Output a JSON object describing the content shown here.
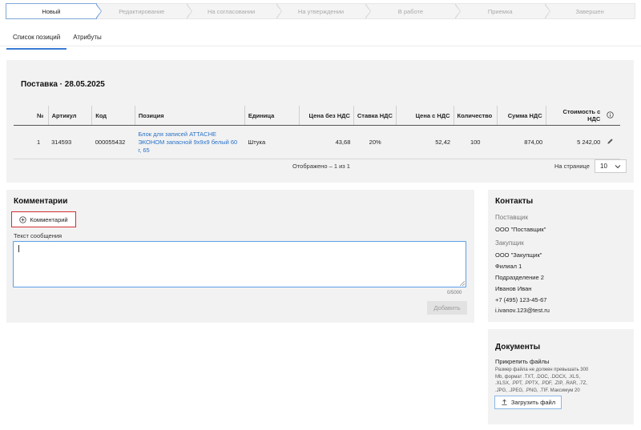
{
  "stepper": [
    "Новый",
    "Редактирование",
    "На согласовании",
    "На утверждении",
    "В работе",
    "Приемка",
    "Завершен"
  ],
  "tabs": [
    "Список позиций",
    "Атрибуты"
  ],
  "delivery": {
    "title": "Поставка · 28.05.2025",
    "columns": {
      "num": "№",
      "article": "Артикул",
      "code": "Код",
      "position": "Позиция",
      "unit": "Единица",
      "price_no_vat": "Цена без НДС",
      "vat_rate": "Ставка НДС",
      "price_vat": "Цена с НДС",
      "qty": "Количество",
      "vat_sum": "Сумма НДС",
      "cost_vat": "Стоимость с НДС"
    },
    "rows": [
      {
        "num": "1",
        "article": "314593",
        "code": "000055432",
        "position": "Блок для записей ATTACHE ЭКОНОМ запасной 9х9х9 белый 60 г, 65",
        "unit": "Штука",
        "price_no_vat": "43,68",
        "vat_rate": "20%",
        "price_vat": "52,42",
        "qty": "100",
        "vat_sum": "874,00",
        "cost_vat": "5 242,00"
      }
    ],
    "shown": "Отображено – 1 из 1",
    "per_page_label": "На странице",
    "per_page": "10"
  },
  "comments": {
    "title": "Комментарии",
    "add_comment": "Комментарий",
    "message_label": "Текст сообщения",
    "message_value": "",
    "counter": "0/5000",
    "submit": "Добавить"
  },
  "contacts": {
    "title": "Контакты",
    "supplier_label": "Поставщик",
    "supplier": "ООО \"Поставщик\"",
    "customer_label": "Закупщик",
    "customer": "ООО \"Закупщик\"",
    "branch": "Филиал 1",
    "department": "Подразделение 2",
    "person": "Иванов Иван",
    "phone": "+7 (495) 123-45-67",
    "email": "i.ivanov.123@test.ru"
  },
  "documents": {
    "title": "Документы",
    "attach_label": "Прикрепить файлы",
    "hint": "Размер файла не должен превышать 300 Mb, формат .TXT, .DOC, .DOCX, .XLS, .XLSX, .PPT, .PPTX, .PDF, .ZIP, .RAR, .7Z, .JPG, .JPEG, .PNG, .TIF. Максимум 20",
    "upload": "Загрузить файл"
  },
  "colors": {
    "accent": "#3a7bd5",
    "link": "#2a72c8",
    "alert_border": "#d32f2f"
  }
}
